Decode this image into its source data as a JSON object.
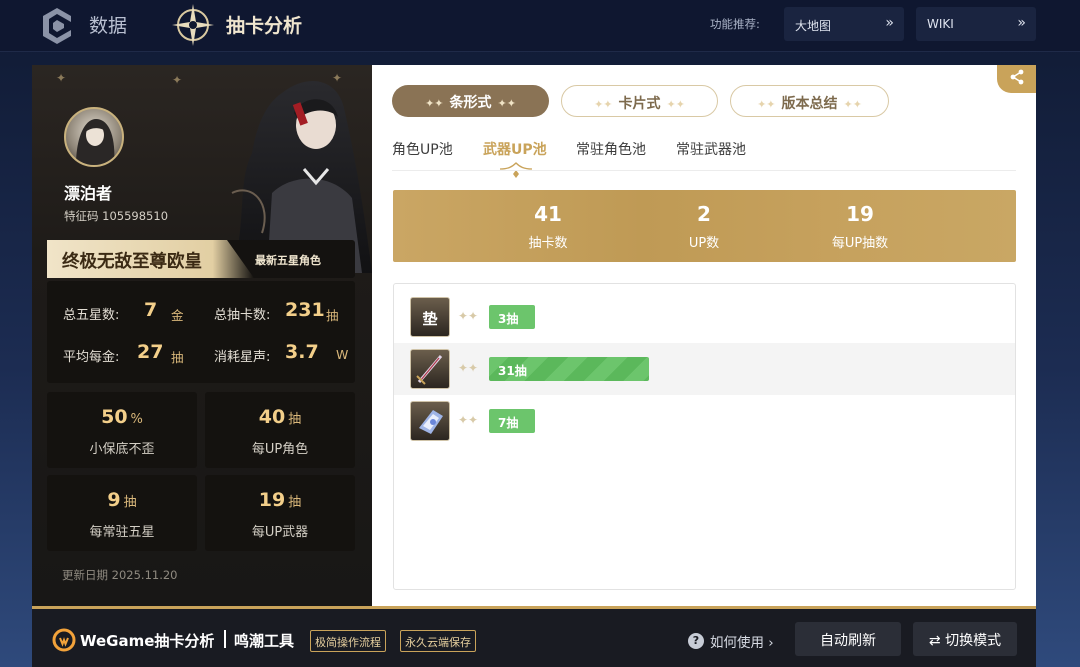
{
  "nav": {
    "data_label": "数据",
    "gacha_label": "抽卡分析",
    "recommend_label": "功能推荐:",
    "links": [
      {
        "label": "大地图"
      },
      {
        "label": "WIKI"
      }
    ]
  },
  "profile": {
    "name": "漂泊者",
    "code": "特征码 105598510",
    "rank_title": "终极无敌至尊欧皇",
    "rank_sub": "最新五星角色",
    "stats": {
      "total_five_label": "总五星数:",
      "total_five_value": "7",
      "total_five_unit": "金",
      "total_pulls_label": "总抽卡数:",
      "total_pulls_value": "231",
      "total_pulls_unit": "抽",
      "avg_gold_label": "平均每金:",
      "avg_gold_value": "27",
      "avg_gold_unit": "抽",
      "astrite_label": "消耗星声:",
      "astrite_value": "3.7",
      "astrite_unit": "W"
    },
    "tiles": [
      {
        "value": "50",
        "unit": "%",
        "label": "小保底不歪"
      },
      {
        "value": "40",
        "unit": "抽",
        "label": "每UP角色"
      },
      {
        "value": "9",
        "unit": "抽",
        "label": "每常驻五星"
      },
      {
        "value": "19",
        "unit": "抽",
        "label": "每UP武器"
      }
    ],
    "update_date": "更新日期 2025.11.20"
  },
  "view_tabs": [
    {
      "label": "条形式",
      "active": true
    },
    {
      "label": "卡片式",
      "active": false
    },
    {
      "label": "版本总结",
      "active": false
    }
  ],
  "pool_tabs": [
    {
      "label": "角色UP池",
      "active": false
    },
    {
      "label": "武器UP池",
      "active": true
    },
    {
      "label": "常驻角色池",
      "active": false
    },
    {
      "label": "常驻武器池",
      "active": false
    }
  ],
  "summary": [
    {
      "value": "41",
      "label": "抽卡数"
    },
    {
      "value": "2",
      "label": "UP数"
    },
    {
      "value": "19",
      "label": "每UP抽数"
    }
  ],
  "records": [
    {
      "icon_text": "垫",
      "icon": "pity-placeholder-icon",
      "pulls": 3,
      "bar_label": "3抽"
    },
    {
      "icon_text": "",
      "icon": "weapon-sword-icon",
      "pulls": 31,
      "bar_label": "31抽"
    },
    {
      "icon_text": "",
      "icon": "weapon-gauntlet-icon",
      "pulls": 7,
      "bar_label": "7抽"
    }
  ],
  "footer": {
    "brand": "WeGame抽卡分析",
    "tool": "鸣潮工具",
    "badges": [
      "极简操作流程",
      "永久云端保存"
    ],
    "help": "如何使用",
    "refresh": "自动刷新",
    "switch": "切换模式"
  },
  "colors": {
    "accent_gold": "#c9a35a",
    "bar_green": "#6cc56c",
    "nav_bg": "#0f1730"
  }
}
